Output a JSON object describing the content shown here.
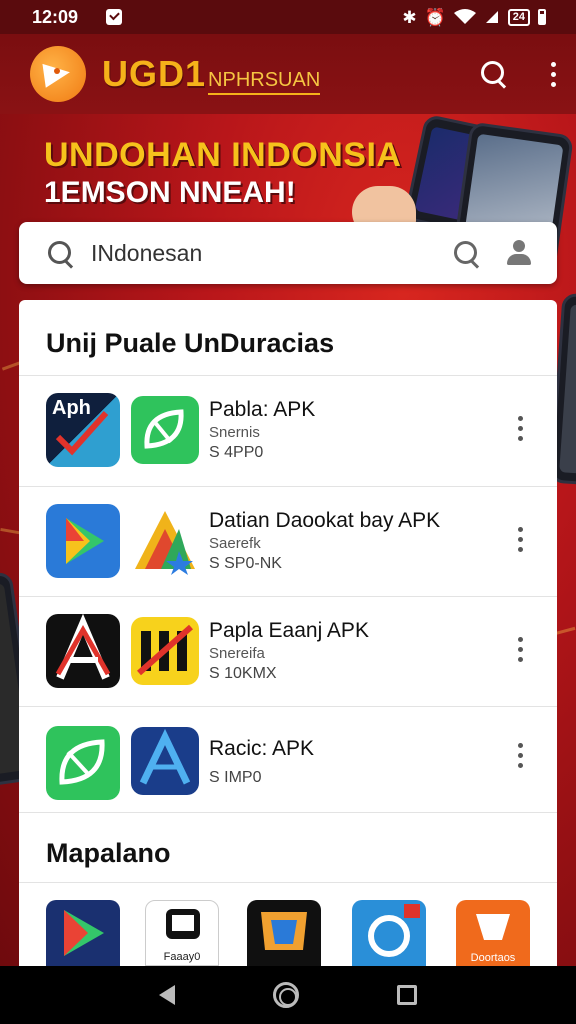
{
  "status_bar": {
    "time": "12:09",
    "battery_label": "24"
  },
  "app_bar": {
    "brand_main": "UGD1",
    "brand_sub": "NPHRSUAN"
  },
  "hero": {
    "title": "UNDOHAN INDONSIA",
    "subtitle": "1EMSON NNEAH!"
  },
  "search": {
    "value": "INdonesan"
  },
  "section_1": {
    "title": "Unij Puale UnDuracias",
    "apps": [
      {
        "name": "Pabla: APK",
        "developer": "Snernis",
        "size": "S 4PP0",
        "icons": [
          "aph-icon",
          "green-leaf-icon"
        ]
      },
      {
        "name": "Datian Daookat bay APK",
        "developer": "Saerefk",
        "size": "S SP0-NK",
        "icons": [
          "play-store-icon",
          "triangle-star-icon"
        ]
      },
      {
        "name": "Papla Eaanj APK",
        "developer": "Snereifa",
        "size": "S 10KMX",
        "icons": [
          "red-a-icon",
          "yellow-stripe-icon"
        ]
      },
      {
        "name": "Racic: APK",
        "developer": "",
        "size": "S IMP0",
        "icons": [
          "green-leaf-icon",
          "blue-a-icon"
        ]
      }
    ]
  },
  "section_2": {
    "title": "Mapalano",
    "captions": [
      "Faaay0",
      "Doortaos"
    ]
  },
  "colors": {
    "app_bar": "#7a0e10",
    "brand_gold": "#f5b21a",
    "hero_red": "#b8161a"
  }
}
